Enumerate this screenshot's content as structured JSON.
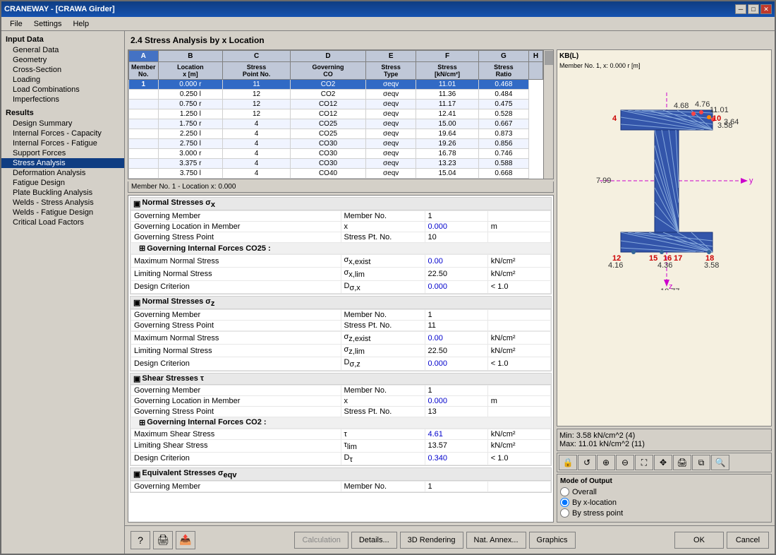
{
  "window": {
    "title": "CRANEWAY - [CRAWA Girder]",
    "close_btn": "✕",
    "min_btn": "─",
    "max_btn": "□"
  },
  "menu": {
    "items": [
      "File",
      "Settings",
      "Help"
    ]
  },
  "sidebar": {
    "section_input": "Input Data",
    "items_input": [
      "General Data",
      "Geometry",
      "Cross-Section",
      "Loading",
      "Load Combinations",
      "Imperfections"
    ],
    "section_results": "Results",
    "items_results": [
      "Design Summary",
      "Internal Forces - Capacity",
      "Internal Forces - Fatigue",
      "Support Forces",
      "Stress Analysis",
      "Deformation Analysis",
      "Fatigue Design",
      "Plate Buckling Analysis",
      "Welds - Stress Analysis",
      "Welds - Fatigue Design",
      "Critical Load Factors"
    ]
  },
  "main_title": "2.4 Stress Analysis by x Location",
  "table": {
    "columns": [
      "A",
      "B",
      "C",
      "D",
      "E",
      "F",
      "G",
      "H"
    ],
    "headers": [
      "Member\nNo.",
      "Location\nx [m]",
      "Stress\nPoint No.",
      "Governing\nCO",
      "Stress\nType",
      "Stress\n[kN/cm²]",
      "Stress\nRatio",
      ""
    ],
    "rows": [
      [
        "1",
        "0.000 r",
        "11",
        "CO2",
        "σeqv",
        "11.01",
        "0.468"
      ],
      [
        "",
        "0.250 l",
        "12",
        "CO2",
        "σeqv",
        "11.36",
        "0.484"
      ],
      [
        "",
        "0.750 r",
        "12",
        "CO12",
        "σeqv",
        "11.17",
        "0.475"
      ],
      [
        "",
        "1.250 l",
        "12",
        "CO12",
        "σeqv",
        "12.41",
        "0.528"
      ],
      [
        "",
        "1.750 r",
        "4",
        "CO25",
        "σeqv",
        "15.00",
        "0.667"
      ],
      [
        "",
        "2.250 l",
        "4",
        "CO25",
        "σeqv",
        "19.64",
        "0.873"
      ],
      [
        "",
        "2.750 l",
        "4",
        "CO30",
        "σeqv",
        "19.26",
        "0.856"
      ],
      [
        "",
        "3.000 r",
        "4",
        "CO30",
        "σeqv",
        "16.78",
        "0.746"
      ],
      [
        "",
        "3.375 r",
        "4",
        "CO30",
        "σeqv",
        "13.23",
        "0.588"
      ],
      [
        "",
        "3.750 l",
        "4",
        "CO40",
        "σeqv",
        "15.04",
        "0.668"
      ]
    ]
  },
  "detail_header": "Member No. 1 - Location x: 0.000",
  "normal_stress_x": {
    "title": "Normal Stresses σx",
    "rows": [
      {
        "label": "Governing Member",
        "col2": "Member No.",
        "col3": "1",
        "col4": ""
      },
      {
        "label": "Governing Location in Member",
        "col2": "x",
        "col3": "0.000",
        "col4": "m"
      },
      {
        "label": "Governing Stress Point",
        "col2": "Stress Pt. No.",
        "col3": "10",
        "col4": ""
      }
    ],
    "sub_title": "Governing Internal Forces CO25 :",
    "sub_rows": [
      {
        "label": "Maximum Normal Stress",
        "col2": "σx,exist",
        "col3": "0.00",
        "col4": "kN/cm²"
      },
      {
        "label": "Limiting Normal Stress",
        "col2": "σx,lim",
        "col3": "22.50",
        "col4": "kN/cm²"
      },
      {
        "label": "Design Criterion",
        "col2": "Dσ,x",
        "col3": "0.000",
        "col4": "< 1.0"
      }
    ]
  },
  "normal_stress_z": {
    "title": "Normal Stresses σz",
    "rows": [
      {
        "label": "Governing Member",
        "col2": "Member No.",
        "col3": "1",
        "col4": ""
      },
      {
        "label": "Governing Stress Point",
        "col2": "Stress Pt. No.",
        "col3": "11",
        "col4": ""
      }
    ],
    "sub_rows": [
      {
        "label": "Maximum Normal Stress",
        "col2": "σz,exist",
        "col3": "0.00",
        "col4": "kN/cm²"
      },
      {
        "label": "Limiting Normal Stress",
        "col2": "σz,lim",
        "col3": "22.50",
        "col4": "kN/cm²"
      },
      {
        "label": "Design Criterion",
        "col2": "Dσ,z",
        "col3": "0.000",
        "col4": "< 1.0"
      }
    ]
  },
  "shear_stress": {
    "title": "Shear Stresses τ",
    "rows": [
      {
        "label": "Governing Member",
        "col2": "Member No.",
        "col3": "1",
        "col4": ""
      },
      {
        "label": "Governing Location in Member",
        "col2": "x",
        "col3": "0.000",
        "col4": "m"
      },
      {
        "label": "Governing Stress Point",
        "col2": "Stress Pt. No.",
        "col3": "13",
        "col4": ""
      }
    ],
    "sub_title": "Governing Internal Forces CO2 :",
    "sub_rows": [
      {
        "label": "Maximum Shear Stress",
        "col2": "τ",
        "col3": "4.61",
        "col4": "kN/cm²"
      },
      {
        "label": "Limiting Shear Stress",
        "col2": "τlim",
        "col3": "13.57",
        "col4": "kN/cm²"
      },
      {
        "label": "Design Criterion",
        "col2": "Dτ",
        "col3": "0.340",
        "col4": "< 1.0"
      }
    ]
  },
  "equiv_stress": {
    "title": "Equivalent Stresses σeqv",
    "rows": [
      {
        "label": "Governing Member",
        "col2": "Member No.",
        "col3": "1",
        "col4": ""
      }
    ]
  },
  "diagram": {
    "title": "KB(L)",
    "subtitle": "Member No. 1, x: 0.000 r [m]",
    "min_label": "Min:",
    "min_value": "3.58  kN/cm^2 (4)",
    "max_label": "Max:",
    "max_value": "11.01  kN/cm^2 (11)"
  },
  "mode_output": {
    "title": "Mode of Output",
    "options": [
      "Overall",
      "By x-location",
      "By stress point"
    ],
    "selected": 1
  },
  "buttons": {
    "calculation": "Calculation",
    "details": "Details...",
    "rendering": "3D Rendering",
    "nat_annex": "Nat. Annex...",
    "graphics": "Graphics",
    "ok": "OK",
    "cancel": "Cancel"
  }
}
